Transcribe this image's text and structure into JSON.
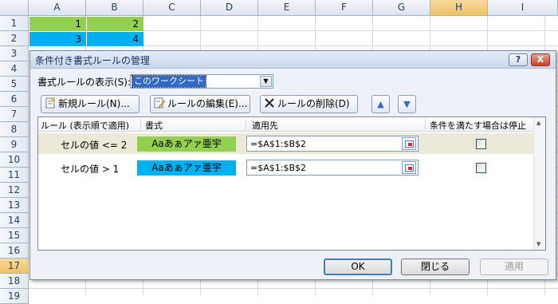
{
  "sheet": {
    "columns": [
      "A",
      "B",
      "C",
      "D",
      "E",
      "F",
      "G",
      "H",
      "I"
    ],
    "selected_column": "H",
    "rows": [
      "1",
      "2",
      "3",
      "4",
      "5",
      "6",
      "7",
      "8",
      "9",
      "10",
      "11",
      "12",
      "13",
      "14",
      "15",
      "16",
      "17",
      "18",
      "19"
    ],
    "selected_row": "17",
    "cells": {
      "A1": "1",
      "B1": "2",
      "A2": "3",
      "B2": "4"
    },
    "colors": {
      "row1_fill": "#92d050",
      "row2_fill": "#00b0f0"
    }
  },
  "dialog": {
    "title": "条件付き書式ルールの管理",
    "help_label": "?",
    "close_label": "X",
    "show_rules_label": "書式ルールの表示(S):",
    "show_rules_value": "このワークシート",
    "toolbar": {
      "new_rule": "新規ルール(N)...",
      "edit_rule": "ルールの編集(E)...",
      "delete_rule": "ルールの削除(D)",
      "move_up": "▲",
      "move_down": "▼"
    },
    "list_headers": {
      "rule": "ルール (表示順で適用)",
      "format": "書式",
      "applies_to": "適用先",
      "stop_if_true": "条件を満たす場合は停止"
    },
    "rules": [
      {
        "rule": "セルの値 <= 2",
        "format_preview": "Aaあぁアァ亜宇",
        "format_color": "#92d050",
        "applies_to": "=$A$1:$B$2",
        "stop_if_true": false,
        "selected": true
      },
      {
        "rule": "セルの値 > 1",
        "format_preview": "Aaあぁアァ亜宇",
        "format_color": "#00b0f0",
        "applies_to": "=$A$1:$B$2",
        "stop_if_true": false,
        "selected": false
      }
    ],
    "buttons": {
      "ok": "OK",
      "close": "閉じる",
      "apply": "適用"
    }
  }
}
